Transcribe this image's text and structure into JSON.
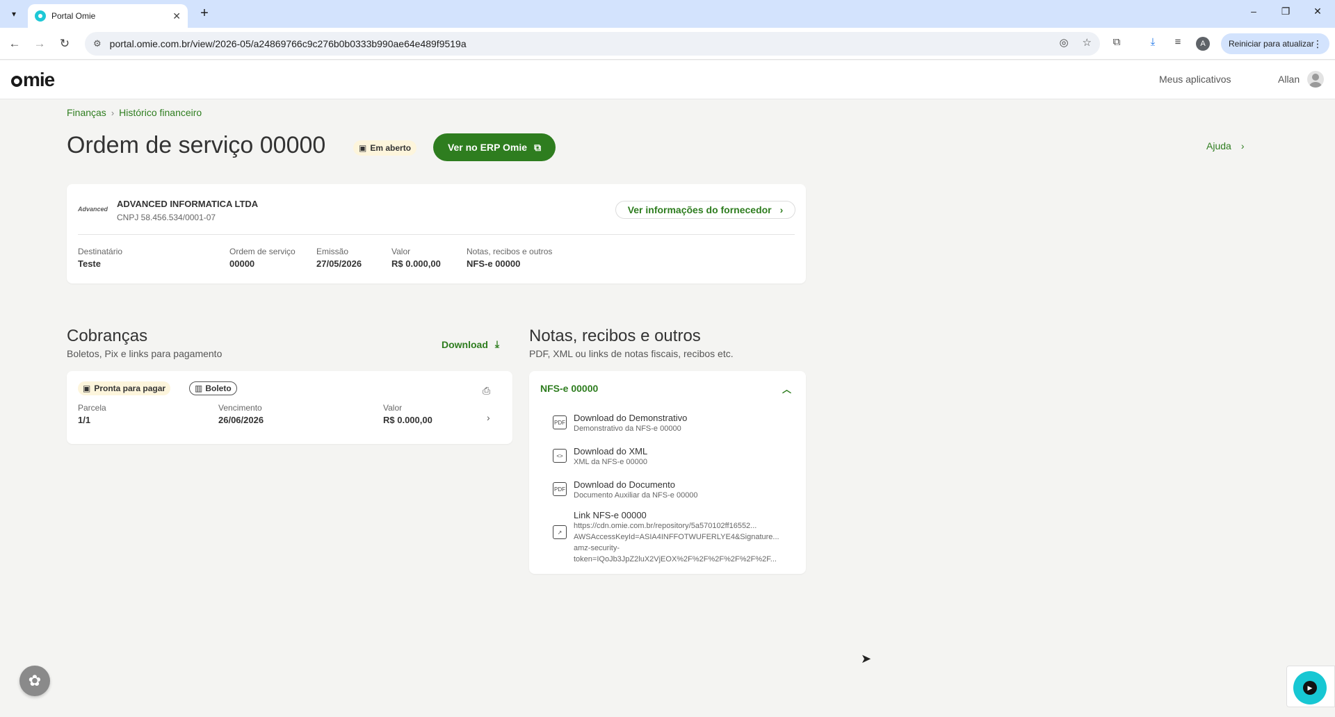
{
  "browser": {
    "tab_title": "Portal Omie",
    "url": "portal.omie.com.br/view/2026-05/a24869766c9c276b0b0333b990ae64e489f9519a",
    "update_label": "Reiniciar para atualizar",
    "profile_initial": "A"
  },
  "header": {
    "logo": "mie",
    "apps_link": "Meus aplicativos",
    "user_name": "Allan"
  },
  "breadcrumb": {
    "items": [
      "Finanças",
      "Histórico financeiro"
    ]
  },
  "page": {
    "title": "Ordem de serviço 00000",
    "status_badge": "Em aberto",
    "erp_button": "Ver no ERP Omie",
    "help_link": "Ajuda"
  },
  "supplier": {
    "logo_text": "Advanced",
    "name": "ADVANCED INFORMATICA LTDA",
    "cnpj": "CNPJ 58.456.534/0001-07",
    "info_button": "Ver informações do fornecedor",
    "fields": [
      {
        "label": "Destinatário",
        "value": "Teste"
      },
      {
        "label": "Ordem de serviço",
        "value": "00000"
      },
      {
        "label": "Emissão",
        "value": "27/05/2026"
      },
      {
        "label": "Valor",
        "value": "R$ 0.000,00"
      },
      {
        "label": "Notas, recibos e outros",
        "value": "NFS-e 00000"
      }
    ]
  },
  "charges": {
    "title": "Cobranças",
    "subtitle": "Boletos, Pix e links para pagamento",
    "download_label": "Download",
    "item": {
      "status_badge": "Pronta para pagar",
      "type_badge": "Boleto",
      "fields": [
        {
          "label": "Parcela",
          "value": "1/1"
        },
        {
          "label": "Vencimento",
          "value": "26/06/2026"
        },
        {
          "label": "Valor",
          "value": "R$ 0.000,00"
        }
      ]
    }
  },
  "notes": {
    "title": "Notas, recibos e outros",
    "subtitle": "PDF, XML ou links de notas fiscais, recibos etc.",
    "group_title": "NFS-e 00000",
    "items": [
      {
        "title": "Download do Demonstrativo",
        "subtitle": "Demonstrativo da NFS-e 00000",
        "icon": "pdf-icon"
      },
      {
        "title": "Download do XML",
        "subtitle": "XML da NFS-e 00000",
        "icon": "code-icon"
      },
      {
        "title": "Download do Documento",
        "subtitle": "Documento Auxiliar da NFS-e 00000",
        "icon": "pdf-icon"
      }
    ],
    "link_item": {
      "title": "Link NFS-e 00000",
      "lines": [
        "https://cdn.omie.com.br/repository/5a570102ff16552...",
        "AWSAccessKeyId=ASIA4INFFOTWUFERLYE4&Signature...",
        "amz-security-",
        "token=IQoJb3JpZ2luX2VjEOX%2F%2F%2F%2F%2F%2F..."
      ],
      "icon": "external-link-icon"
    }
  },
  "colors": {
    "brand_green": "#2e7d1f",
    "badge_yellow": "#fdf5dc",
    "chat_accent": "#17c7d3"
  }
}
